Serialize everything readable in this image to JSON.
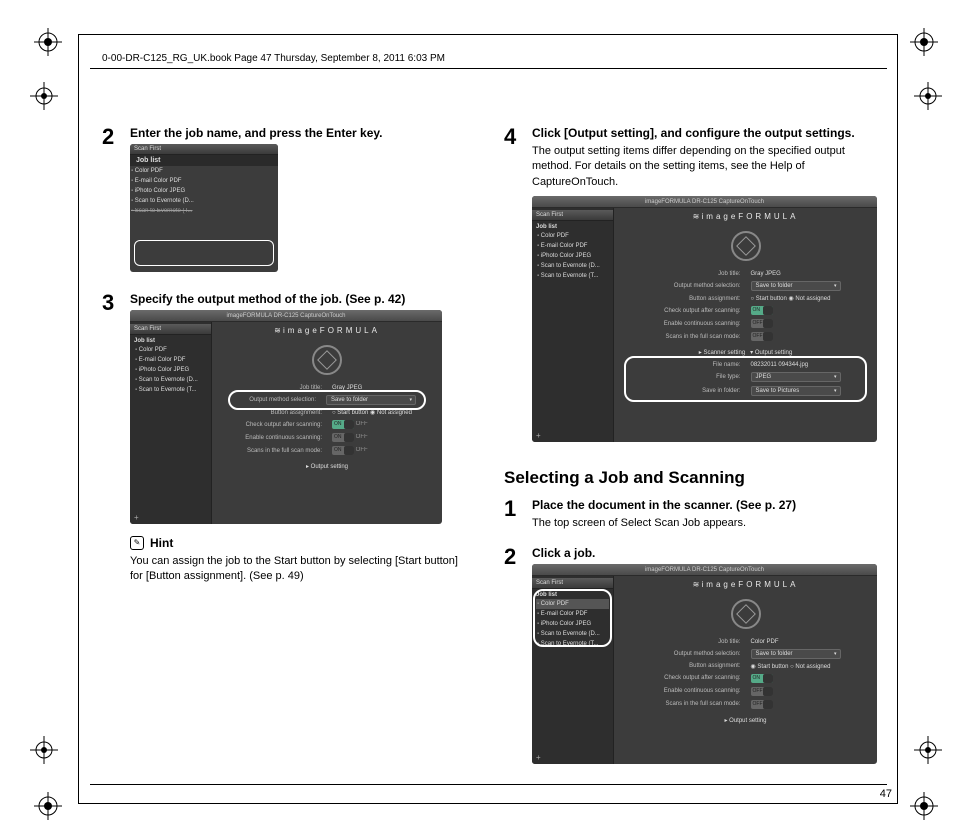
{
  "header": "0-00-DR-C125_RG_UK.book  Page 47  Thursday, September 8, 2011  6:03 PM",
  "page_number": "47",
  "left_col": {
    "step2": {
      "num": "2",
      "title": "Enter the job name, and press the Enter key.",
      "shot": {
        "panel_header": "Scan First",
        "list_header": "Job list",
        "items": [
          "Color PDF",
          "E-mail Color PDF",
          "iPhoto Color JPEG",
          "Scan to Evernote (D...",
          "Scan to Evernote (T..."
        ]
      }
    },
    "step3": {
      "num": "3",
      "title": "Specify the output method of the job. (See p. 42)",
      "shot": {
        "titlebar": "imageFORMULA DR-C125 CaptureOnTouch",
        "brand": "imageFORMULA",
        "sidebar": {
          "h1": "Scan First",
          "h2": "Job list",
          "items": [
            "Color PDF",
            "E-mail Color PDF",
            "iPhoto Color JPEG",
            "Scan to Evernote (D...",
            "Scan to Evernote (T..."
          ]
        },
        "rows": {
          "job_title": "Job title:",
          "job_title_val": "Gray JPEG",
          "method": "Output method selection:",
          "method_val": "Save to folder",
          "button_assign": "Button assignment:",
          "ba_opt1": "Start button",
          "ba_opt2": "Not assigned",
          "check_output": "Check output after scanning:",
          "cont_scan": "Enable continuous scanning:",
          "full_scan": "Scans in the full scan mode:",
          "on": "ON",
          "off": "OFF",
          "output_setting": "Output setting"
        }
      }
    },
    "hint": {
      "label": "Hint",
      "text": "You can assign the job to the Start button by selecting [Start button] for [Button assignment]. (See p. 49)"
    }
  },
  "right_col": {
    "step4": {
      "num": "4",
      "title": "Click [Output setting], and configure the output settings.",
      "desc": "The output setting items differ depending on the specified output method. For details on the setting items, see the Help of CaptureOnTouch.",
      "shot": {
        "titlebar": "imageFORMULA DR-C125 CaptureOnTouch",
        "brand": "imageFORMULA",
        "sidebar": {
          "h1": "Scan First",
          "h2": "Job list",
          "items": [
            "Color PDF",
            "E-mail Color PDF",
            "iPhoto Color JPEG",
            "Scan to Evernote (D...",
            "Scan to Evernote (T..."
          ]
        },
        "rows": {
          "job_title": "Job title:",
          "job_title_val": "Gray JPEG",
          "method": "Output method selection:",
          "method_val": "Save to folder",
          "button_assign": "Button assignment:",
          "ba_opt1": "Start button",
          "ba_opt2": "Not assigned",
          "check_output": "Check output after scanning:",
          "cont_scan": "Enable continuous scanning:",
          "full_scan": "Scans in the full scan mode:",
          "on": "ON",
          "off": "OFF",
          "scanner_setting": "Scanner setting",
          "output_setting": "Output setting",
          "file_name": "File name:",
          "file_name_val": "08232011 094344.jpg",
          "file_type": "File type:",
          "file_type_val": "JPEG",
          "save_in": "Save in folder:",
          "save_in_val": "Save to Pictures"
        }
      }
    },
    "section_heading": "Selecting a Job and Scanning",
    "step1b": {
      "num": "1",
      "title": "Place the document in the scanner. (See p. 27)",
      "desc": "The top screen of Select Scan Job appears."
    },
    "step2b": {
      "num": "2",
      "title": "Click a job.",
      "shot": {
        "titlebar": "imageFORMULA DR-C125 CaptureOnTouch",
        "brand": "imageFORMULA",
        "sidebar": {
          "h1": "Scan First",
          "h2": "Job list",
          "items": [
            "Color PDF",
            "E-mail Color PDF",
            "iPhoto Color JPEG",
            "Scan to Evernote (D...",
            "Scan to Evernote (T..."
          ]
        },
        "rows": {
          "job_title": "Job title:",
          "job_title_val": "Color PDF",
          "method": "Output method selection:",
          "method_val": "Save to folder",
          "button_assign": "Button assignment:",
          "ba_opt1": "Start button",
          "ba_opt2": "Not assigned",
          "check_output": "Check output after scanning:",
          "cont_scan": "Enable continuous scanning:",
          "full_scan": "Scans in the full scan mode:",
          "on": "ON",
          "off": "OFF",
          "output_setting": "Output setting"
        }
      }
    }
  }
}
